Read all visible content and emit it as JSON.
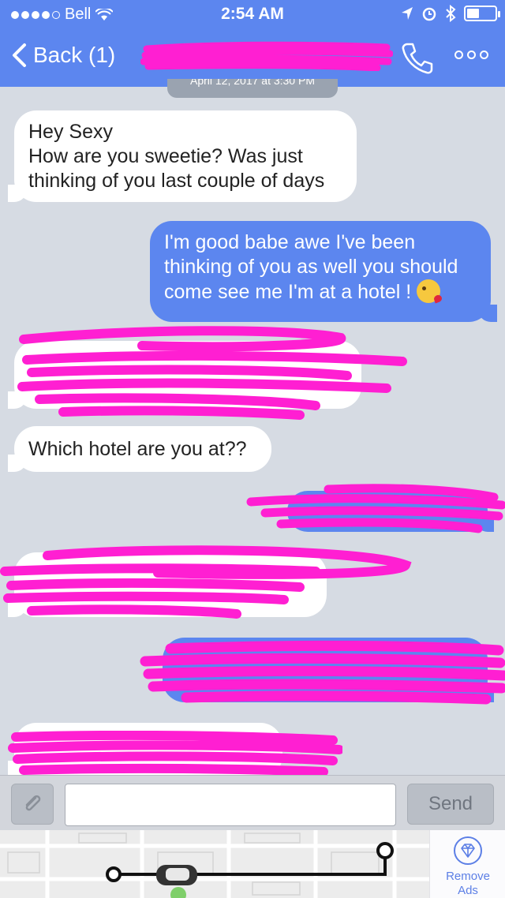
{
  "status_bar": {
    "carrier": "Bell",
    "time": "2:54 AM",
    "battery_level": 0.45
  },
  "nav": {
    "back_label": "Back (1)",
    "call_icon": "phone-icon",
    "more_icon": "more-icon"
  },
  "thread": {
    "timestamp_partial": "April 12, 2017 at 3:30 PM"
  },
  "messages": [
    {
      "direction": "incoming",
      "text": "Hey Sexy\nHow are you sweetie? Was just\nthinking of you last couple of days"
    },
    {
      "direction": "outgoing",
      "text": "I'm good babe awe I've been\nthinking of you as well you should\ncome see me I'm at a hotel ! ",
      "emoji": "kiss-emoji"
    },
    {
      "direction": "incoming",
      "redacted": true
    },
    {
      "direction": "incoming",
      "text": "Which hotel are you at??"
    },
    {
      "direction": "outgoing",
      "redacted": true
    },
    {
      "direction": "incoming",
      "redacted": true
    },
    {
      "direction": "outgoing",
      "redacted": true
    },
    {
      "direction": "incoming",
      "redacted": true
    }
  ],
  "composer": {
    "input_value": "",
    "send_label": "Send",
    "attach_icon": "paperclip-icon"
  },
  "ad": {
    "remove_ads_label": "Remove\nAds",
    "icon": "diamond-icon"
  },
  "colors": {
    "accent": "#5c86ef",
    "redaction": "#ff1fd2",
    "incoming_bubble": "#ffffff",
    "background": "#d6dbe3"
  }
}
